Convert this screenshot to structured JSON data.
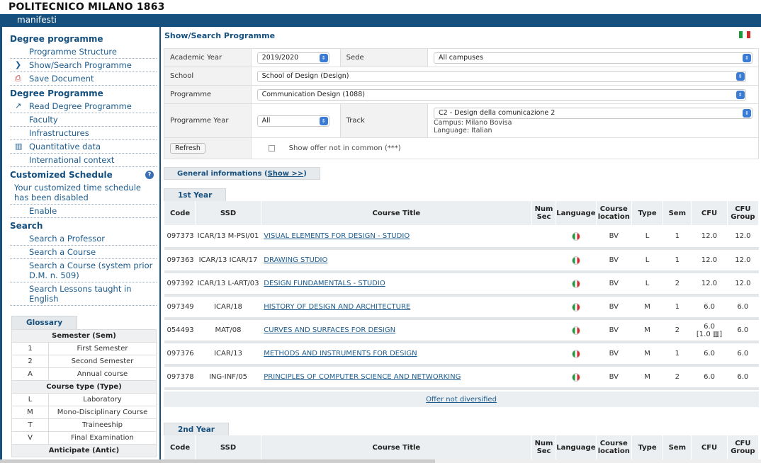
{
  "header": {
    "brand": "POLITECNICO MILANO 1863",
    "section": "manifesti"
  },
  "sidebar": {
    "sections": [
      {
        "title": "Degree programme",
        "items": [
          {
            "label": "Programme Structure",
            "icon": ""
          },
          {
            "label": "Show/Search Programme",
            "icon": "chevron-right-icon"
          },
          {
            "label": "Save Document",
            "icon": "pdf-icon"
          }
        ]
      },
      {
        "title": "Degree Programme",
        "items": [
          {
            "label": "Read Degree Programme",
            "icon": "external-link-icon"
          },
          {
            "label": "Faculty",
            "icon": ""
          },
          {
            "label": "Infrastructures",
            "icon": ""
          },
          {
            "label": "Quantitative data",
            "icon": "bar-chart-icon"
          },
          {
            "label": "International context",
            "icon": ""
          }
        ]
      },
      {
        "title": "Customized Schedule",
        "help_icon": "help-icon",
        "items": [
          {
            "label": "Your customized time schedule has been disabled",
            "icon": "",
            "plain": true
          },
          {
            "label": "Enable",
            "icon": ""
          }
        ]
      },
      {
        "title": "Search",
        "items": [
          {
            "label": "Search a Professor",
            "icon": ""
          },
          {
            "label": "Search a Course",
            "icon": ""
          },
          {
            "label": "Search a Course (system prior D.M. n. 509)",
            "icon": ""
          },
          {
            "label": "Search Lessons taught in English",
            "icon": ""
          }
        ]
      }
    ],
    "glossary": {
      "tab": "Glossary",
      "groups": [
        {
          "heading": "Semester (Sem)",
          "rows": [
            [
              "1",
              "First Semester"
            ],
            [
              "2",
              "Second Semester"
            ],
            [
              "A",
              "Annual course"
            ]
          ]
        },
        {
          "heading": "Course type (Type)",
          "rows": [
            [
              "L",
              "Laboratory"
            ],
            [
              "M",
              "Mono-Disciplinary Course"
            ],
            [
              "T",
              "Traineeship"
            ],
            [
              "V",
              "Final Examination"
            ]
          ]
        },
        {
          "heading": "Anticipate (Antic)",
          "rows": []
        }
      ]
    }
  },
  "main": {
    "title": "Show/Search Programme",
    "flag_colors": [
      "#1a9a3a",
      "#ffffff",
      "#d02a2a"
    ],
    "form": {
      "academic_year_label": "Academic Year",
      "academic_year": "2019/2020",
      "sede_label": "Sede",
      "sede": "All campuses",
      "school_label": "School",
      "school": "School of Design (Design)",
      "programme_label": "Programme",
      "programme": "Communication Design (1088)",
      "programme_year_label": "Programme Year",
      "programme_year": "All",
      "track_label": "Track",
      "track": "C2 - Design della comunicazione 2",
      "campus": "Campus: Milano Bovisa",
      "language": "Language: Italian",
      "refresh": "Refresh",
      "show_offer": "Show offer not in common (***)"
    },
    "general_info": {
      "label": "General informations (",
      "link": "Show >>",
      "close": ")"
    },
    "columns": {
      "code": "Code",
      "ssd": "SSD",
      "title": "Course Title",
      "num_sec": "Num Sec",
      "language": "Language",
      "location": "Course location",
      "type": "Type",
      "sem": "Sem",
      "cfu": "CFU",
      "cfu_group": "CFU Group"
    },
    "years": [
      {
        "tab": "1st Year",
        "offer_link": "Offer not diversified",
        "courses": [
          {
            "code": "097373",
            "ssd": "ICAR/13 M-PSI/01",
            "title": "VISUAL ELEMENTS FOR DESIGN - STUDIO",
            "location": "BV",
            "type": "L",
            "sem": "1",
            "cfu": "12.0",
            "cfu_group": "12.0"
          },
          {
            "code": "097363",
            "ssd": "ICAR/13 ICAR/17",
            "title": "DRAWING STUDIO",
            "location": "BV",
            "type": "L",
            "sem": "1",
            "cfu": "12.0",
            "cfu_group": "12.0"
          },
          {
            "code": "097392",
            "ssd": "ICAR/13 L-ART/03",
            "title": "DESIGN FUNDAMENTALS - STUDIO",
            "location": "BV",
            "type": "L",
            "sem": "2",
            "cfu": "12.0",
            "cfu_group": "12.0"
          },
          {
            "code": "097349",
            "ssd": "ICAR/18",
            "title": "HISTORY OF DESIGN AND ARCHITECTURE",
            "location": "BV",
            "type": "M",
            "sem": "1",
            "cfu": "6.0",
            "cfu_group": "6.0"
          },
          {
            "code": "054493",
            "ssd": "MAT/08",
            "title": "CURVES AND SURFACES FOR DESIGN",
            "location": "BV",
            "type": "M",
            "sem": "2",
            "cfu": "6.0",
            "cfu_extra": "[1.0 ▥]",
            "cfu_group": "6.0"
          },
          {
            "code": "097376",
            "ssd": "ICAR/13",
            "title": "METHODS AND INSTRUMENTS FOR DESIGN",
            "location": "BV",
            "type": "M",
            "sem": "1",
            "cfu": "6.0",
            "cfu_group": "6.0"
          },
          {
            "code": "097378",
            "ssd": "ING-INF/05",
            "title": "PRINCIPLES OF COMPUTER SCIENCE AND NETWORKING",
            "location": "BV",
            "type": "M",
            "sem": "2",
            "cfu": "6.0",
            "cfu_group": "6.0"
          }
        ]
      },
      {
        "tab": "2nd Year",
        "courses": []
      }
    ]
  }
}
